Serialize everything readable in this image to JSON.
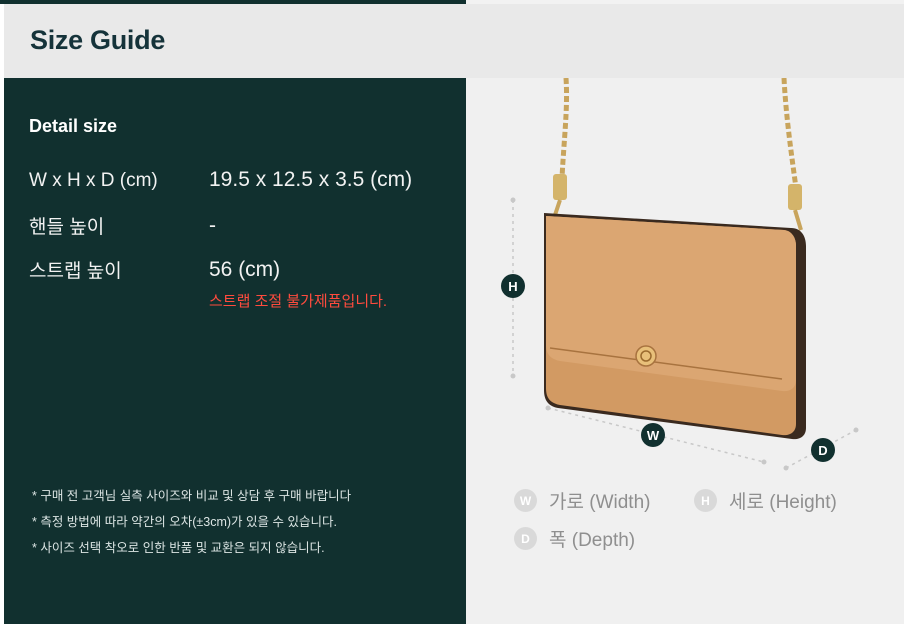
{
  "header": {
    "title": "Size Guide"
  },
  "detail": {
    "title": "Detail size",
    "rows": [
      {
        "label": "W x H x D (cm)",
        "value": "19.5 x 12.5 x 3.5 (cm)"
      },
      {
        "label": "핸들 높이",
        "value": "-"
      },
      {
        "label": "스트랩 높이",
        "value": "56 (cm)",
        "note": "스트랩 조절 불가제품입니다."
      }
    ]
  },
  "footnotes": [
    "* 구매 전 고객님 실측 사이즈와 비교 및 상담 후 구매 바랍니다",
    "* 측정 방법에 따라 약간의 오차(±3cm)가 있을 수 있습니다.",
    "* 사이즈 선택 착오로 인한 반품 및 교환은 되지 않습니다."
  ],
  "diagram": {
    "marker_h": "H",
    "marker_w": "W",
    "marker_d": "D"
  },
  "legend": [
    {
      "letter": "W",
      "text": "가로 (Width)"
    },
    {
      "letter": "H",
      "text": "세로 (Height)"
    },
    {
      "letter": "D",
      "text": "폭 (Depth)"
    }
  ],
  "colors": {
    "panel_dark": "#11302f",
    "header_bg": "#e9e9e9",
    "title_text": "#15333a",
    "note_red": "#ff4b3e",
    "bag_tan": "#d29a63"
  }
}
